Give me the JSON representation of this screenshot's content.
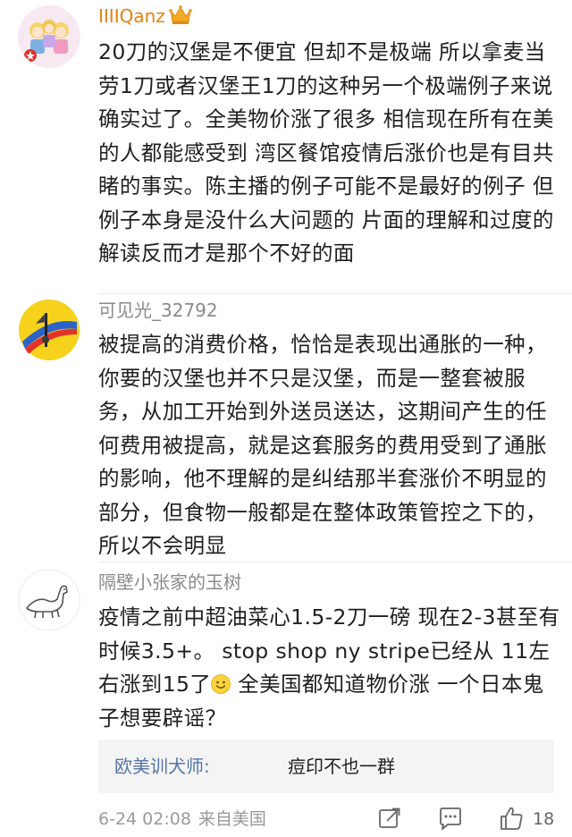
{
  "comments": [
    {
      "username": "IIIIQanz",
      "badge_icon": "crown-icon",
      "text": "20刀的汉堡是不便宜 但却不是极端 所以拿麦当劳1刀或者汉堡王1刀的这种另一个极端例子来说确实过了。全美物价涨了很多 相信现在所有在美的人都能感受到 湾区餐馆疫情后涨价也是有目共睹的事实。陈主播的例子可能不是最好的例子 但例子本身是没什么大问题的 片面的理解和过度的解读反而才是那个不好的面"
    },
    {
      "username": "可见光_32792",
      "text": "被提高的消费价格，恰恰是表现出通胀的一种，你要的汉堡也并不只是汉堡，而是一整套被服务，从加工开始到外送员送达，这期间产生的任何费用被提高，就是这套服务的费用受到了通胀的影响，他不理解的是纠结那半套涨价不明显的部分，但食物一般都是在整体政策管控之下的，所以不会明显"
    },
    {
      "username": "隔壁小张家的玉树",
      "text_part1": "疫情之前中超油菜心1.5-2刀一磅 现在2-3甚至有时候3.5+。 stop shop ny stripe已经从 11左右涨到15了",
      "emoji_icon": "smile-emoji-icon",
      "text_part2": " 全美国都知道物价涨 一个日本鬼子想要辟谣？"
    }
  ],
  "reply": {
    "name": "欧美训犬师:",
    "text": "痘印不也一群"
  },
  "footer": {
    "time": "6-24 02:08",
    "source": "来自美国",
    "like_count": "18"
  },
  "colors": {
    "vip_name": "#e6800e",
    "plain_name": "#8a8a8a",
    "reply_name": "#5576a6",
    "reply_bg": "#f4f4f4"
  }
}
